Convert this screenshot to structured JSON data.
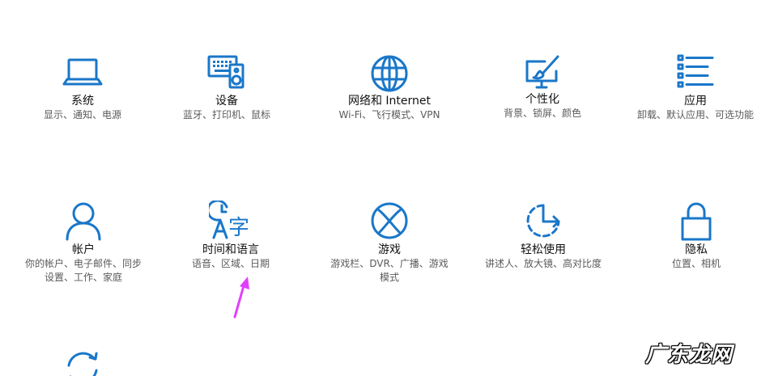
{
  "tiles": [
    {
      "title": "系统",
      "desc1": "显示、通知、电源",
      "desc2": "",
      "icon": "laptop-icon"
    },
    {
      "title": "设备",
      "desc1": "蓝牙、打印机、鼠标",
      "desc2": "",
      "icon": "keyboard-speaker-icon"
    },
    {
      "title": "网络和 Internet",
      "desc1": "Wi-Fi、飞行模式、VPN",
      "desc2": "",
      "icon": "globe-icon"
    },
    {
      "title": "个性化",
      "desc1": "背景、锁屏、颜色",
      "desc2": "",
      "icon": "paint-monitor-icon"
    },
    {
      "title": "应用",
      "desc1": "卸载、默认应用、可选功能",
      "desc2": "",
      "icon": "list-icon"
    },
    {
      "title": "帐户",
      "desc1": "你的帐户、电子邮件、同步",
      "desc2": "设置、工作、家庭",
      "icon": "person-icon"
    },
    {
      "title": "时间和语言",
      "desc1": "语音、区域、日期",
      "desc2": "",
      "icon": "time-language-icon"
    },
    {
      "title": "游戏",
      "desc1": "游戏栏、DVR、广播、游戏",
      "desc2": "模式",
      "icon": "xbox-icon"
    },
    {
      "title": "轻松使用",
      "desc1": "讲述人、放大镜、高对比度",
      "desc2": "",
      "icon": "ease-of-access-icon"
    },
    {
      "title": "隐私",
      "desc1": "位置、相机",
      "desc2": "",
      "icon": "lock-icon"
    }
  ],
  "partial_tile": {
    "icon": "update-sync-icon"
  },
  "annotation": {
    "icon": "pink-arrow-icon",
    "color": "#e040fb"
  },
  "watermark": {
    "text": "广东龙网"
  },
  "colors": {
    "accent": "#1a77c9",
    "title": "#111111",
    "desc": "#5a5a5a"
  }
}
